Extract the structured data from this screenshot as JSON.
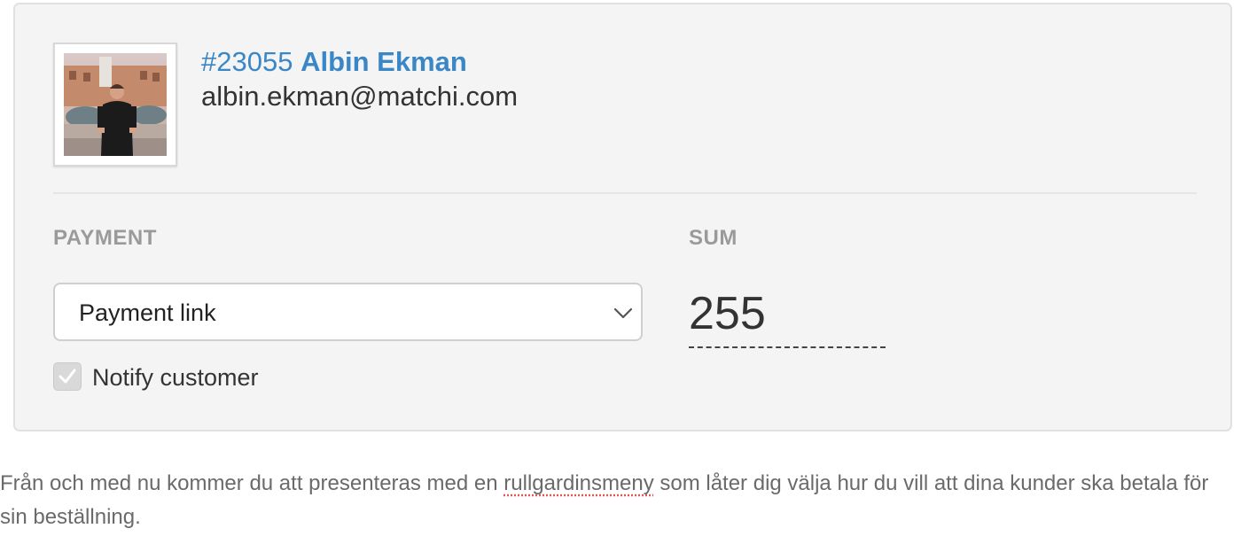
{
  "customer": {
    "id": "#23055",
    "name": "Albin Ekman",
    "email": "albin.ekman@matchi.com"
  },
  "payment": {
    "label": "PAYMENT",
    "selected_option": "Payment link",
    "notify_label": "Notify customer",
    "notify_checked": true
  },
  "sum": {
    "label": "SUM",
    "value": "255"
  },
  "caption": {
    "before": "Från och med nu kommer du att presenteras med en ",
    "misspelled_word": "rullgardinsmeny",
    "after": " som låter dig välja hur du vill att dina kunder ska betala för sin beställning."
  },
  "icons": {
    "select": "chevron-down-icon",
    "checkbox": "checkmark-icon"
  },
  "colors": {
    "link_blue": "#3a87c8",
    "card_background": "#f4f4f4",
    "label_gray": "#9a9a9a",
    "spellcheck_red": "#e05555"
  }
}
